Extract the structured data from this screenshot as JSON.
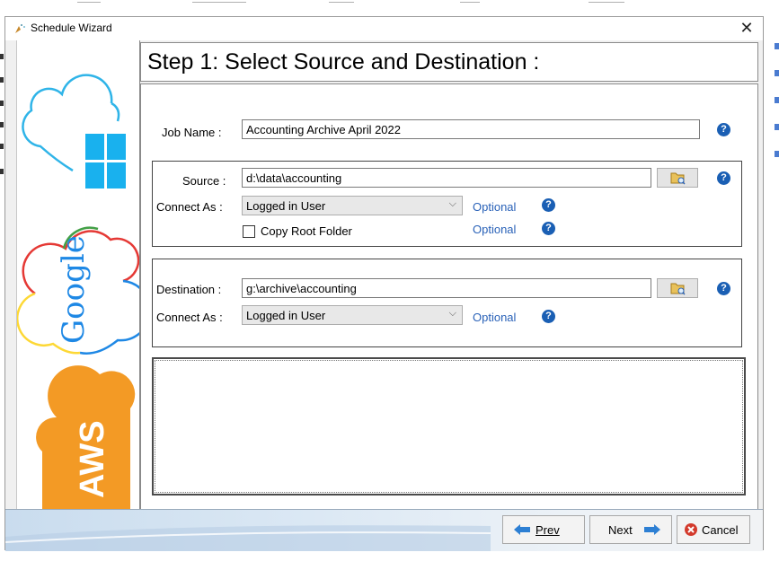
{
  "window": {
    "title": "Schedule Wizard",
    "close_glyph": "✕"
  },
  "header": {
    "title": "Step 1: Select Source and Destination :"
  },
  "sidebar": {
    "logos": [
      {
        "name": "windows-cloud-logo"
      },
      {
        "name": "google-cloud-logo",
        "text": "Google"
      },
      {
        "name": "aws-cloud-logo",
        "text": "AWS"
      }
    ]
  },
  "job": {
    "label": "Job Name :",
    "value": "Accounting Archive April 2022"
  },
  "source": {
    "label": "Source :",
    "value": "d:\\data\\accounting",
    "connect_label": "Connect As :",
    "connect_value": "Logged in User",
    "optional1": "Optional",
    "copy_root_label": "Copy Root Folder",
    "copy_root_checked": false,
    "optional2": "Optional"
  },
  "destination": {
    "label": "Destination :",
    "value": "g:\\archive\\accounting",
    "connect_label": "Connect As :",
    "connect_value": "Logged in User",
    "optional": "Optional"
  },
  "help_glyph": "?",
  "footer": {
    "prev_label": "Prev",
    "next_label": "Next",
    "cancel_label": "Cancel"
  },
  "colors": {
    "accent": "#1a5fb4",
    "link": "#2a62b8",
    "aws": "#f39a25"
  }
}
